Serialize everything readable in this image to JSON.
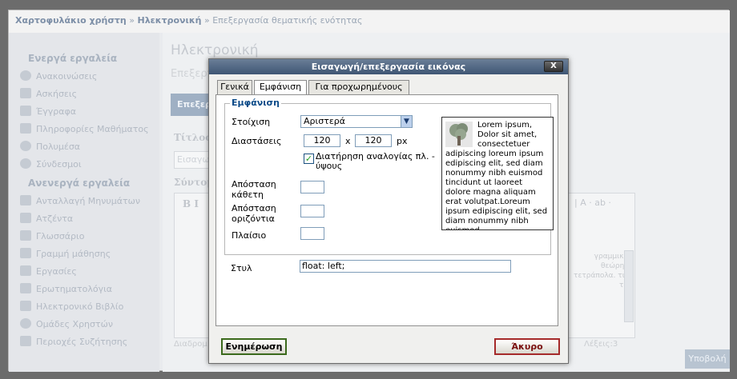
{
  "breadcrumb": {
    "part1": "Χαρτοφυλάκιο χρήστη",
    "sep1": " » ",
    "part2": "Ηλεκτρονική",
    "sep2": " » ",
    "part3": "Επεξεργασία θεματικής ενότητας"
  },
  "sidebar": {
    "active_heading": "Ενεργά εργαλεία",
    "active_items": [
      "Ανακοινώσεις",
      "Ασκήσεις",
      "Έγγραφα",
      "Πληροφορίες Μαθήματος",
      "Πολυμέσα",
      "Σύνδεσμοι"
    ],
    "inactive_heading": "Ανενεργά εργαλεία",
    "inactive_items": [
      "Ανταλλαγή Μηνυμάτων",
      "Ατζέντα",
      "Γλωσσάριο",
      "Γραμμή μάθησης",
      "Εργασίες",
      "Ερωτηματολόγια",
      "Ηλεκτρονικό Βιβλίο",
      "Ομάδες Χρηστών",
      "Περιοχές Συζήτησης"
    ]
  },
  "main": {
    "title": "Ηλεκτρονική",
    "subtitle": "Επεξεργ",
    "section_bar": "Επεξεργ",
    "title_label": "Τίτλος θ",
    "title_input": "Εισαγω",
    "short_label": "Σύντομη",
    "editor_bold": "B  I",
    "editor_right_toolbar": "| A ·  ab ·",
    "editor_right_text": "γραμμικών θεώρημα τετράπολα. τικά των",
    "editor_status": "Διαδρομ",
    "words_label": "Λέξεις:3",
    "submit_label": "Υποβολή"
  },
  "dialog": {
    "title": "Εισαγωγή/επεξεργασία εικόνας",
    "close_label": "X",
    "tabs": [
      "Γενικά",
      "Εμφάνιση",
      "Για προχωρημένους"
    ],
    "legend": "Εμφάνιση",
    "alignment_label": "Στοίχιση",
    "alignment_value": "Αριστερά",
    "dimensions_label": "Διαστάσεις",
    "width": "120",
    "times": "x",
    "height": "120",
    "unit": "px",
    "keep_ratio_label": "Διατήρηση αναλογίας πλ. - ύψους",
    "vspace_label": "Απόσταση κάθετη",
    "vspace_value": "",
    "hspace_label": "Απόσταση οριζόντια",
    "hspace_value": "",
    "border_label": "Πλαίσιο",
    "border_value": "",
    "style_label": "Στυλ",
    "style_value": "float: left;",
    "preview_text": "Lorem ipsum, Dolor sit amet, consectetuer adipiscing loreum ipsum edipiscing elit, sed diam nonummy nibh euismod tincidunt ut laoreet dolore magna aliquam erat volutpat.Loreum ipsum edipiscing elit, sed diam nonummy nibh euismod",
    "update_button": "Ενημέρωση",
    "cancel_button": "Άκυρο"
  },
  "colors": {
    "title_bar": "#4a5f7c",
    "legend": "#0b4a88",
    "update_border": "#3b6a1c",
    "cancel_border": "#a52a2a"
  }
}
